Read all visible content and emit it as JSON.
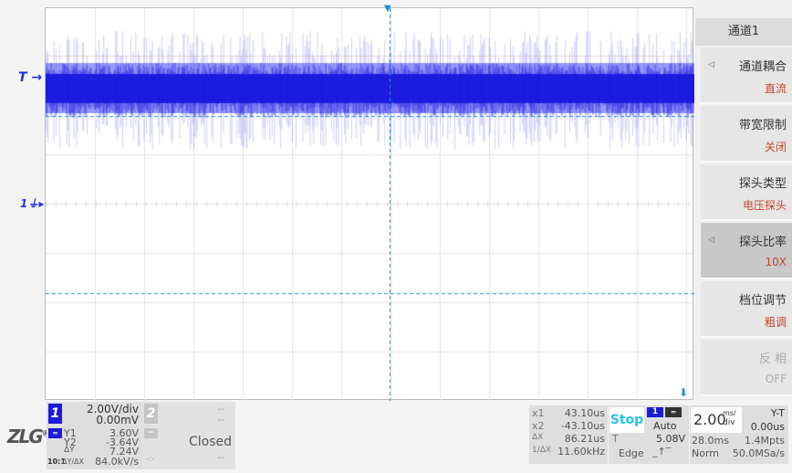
{
  "colors": {
    "trace": "#1a1ae6",
    "cursor": "#1e8fe0",
    "accent": "#1b1bd8",
    "menu_value": "#c8462a",
    "stop": "#29c3e8"
  },
  "markers": {
    "trigger": "T",
    "channel1": "1"
  },
  "menu": {
    "title": "通道1",
    "items": [
      {
        "label": "通道耦合",
        "value": "直流",
        "arrow": true,
        "selected": false,
        "disabled": false
      },
      {
        "label": "带宽限制",
        "value": "关闭",
        "arrow": false,
        "selected": false,
        "disabled": false
      },
      {
        "label": "探头类型",
        "value": "电压探头",
        "arrow": false,
        "selected": false,
        "disabled": false
      },
      {
        "label": "探头比率",
        "value": "10X",
        "arrow": true,
        "selected": true,
        "disabled": false
      },
      {
        "label": "档位调节",
        "value": "粗调",
        "arrow": false,
        "selected": false,
        "disabled": false
      },
      {
        "label": "反 相",
        "value": "OFF",
        "arrow": false,
        "selected": false,
        "disabled": true
      }
    ]
  },
  "logo": "ZLG",
  "ch1": {
    "num": "1",
    "scale": "2.00V/div",
    "offset": "0.00mV",
    "probe": "10:1",
    "y1_label": "Y1",
    "y1": "3.60V",
    "y2_label": "Y2",
    "y2": "-3.64V",
    "dy_label": "ΔY",
    "dy": "7.24V",
    "slope_label": "ΔY/ΔX",
    "slope": "84.0kV/s"
  },
  "ch2": {
    "num": "2",
    "scale": "--",
    "offset": "--",
    "status": "Closed",
    "extra": "--",
    "extra2": "-:-",
    "minus": "−"
  },
  "cursors": {
    "x1_label": "x1",
    "x1": "43.10us",
    "x2_label": "x2",
    "x2": "-43.10us",
    "dx_label": "ΔX",
    "dx": "86.21us",
    "inv_label": "1/ΔX",
    "inv": "11.60kHz"
  },
  "trigger": {
    "state": "Stop",
    "source": "1",
    "mode": "Auto",
    "level_label": "T",
    "level": "5.08V",
    "type": "Edge"
  },
  "timebase": {
    "value": "2.00",
    "unit_top": "ms/",
    "unit_bot": "div",
    "mode": "Y-T",
    "delay": "0.00us",
    "span": "28.0ms",
    "depth": "1.4Mpts",
    "acq": "Norm",
    "rate": "50.0MSa/s"
  }
}
